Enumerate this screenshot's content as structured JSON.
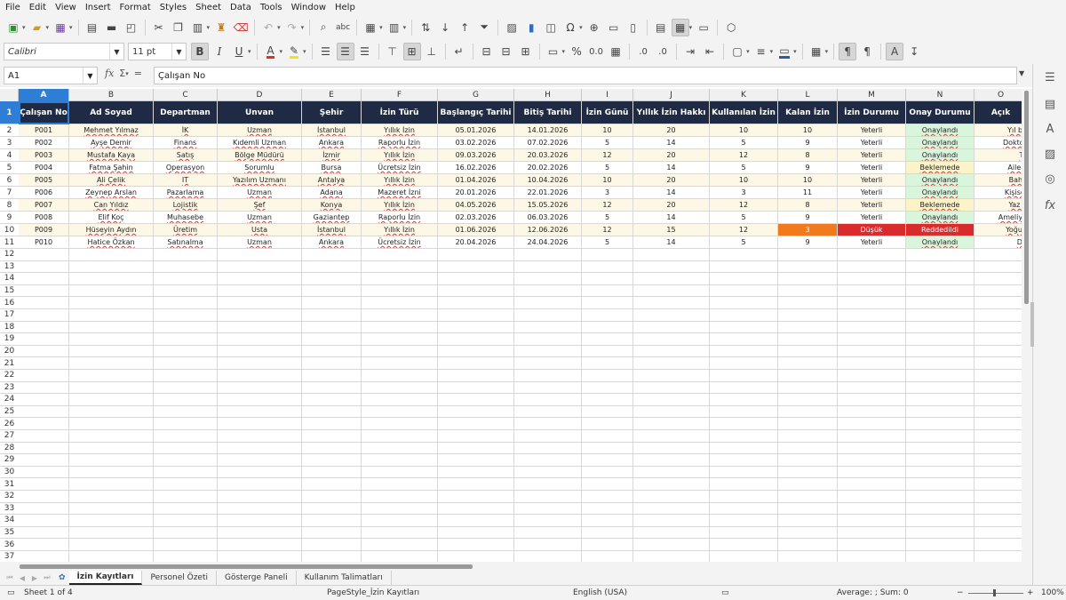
{
  "menu": [
    "File",
    "Edit",
    "View",
    "Insert",
    "Format",
    "Styles",
    "Sheet",
    "Data",
    "Tools",
    "Window",
    "Help"
  ],
  "format_bar": {
    "font_name": "Calibri",
    "font_size": "11 pt"
  },
  "formula_bar": {
    "cell_ref": "A1",
    "content": "Çalışan No"
  },
  "columns": [
    "A",
    "B",
    "C",
    "D",
    "E",
    "F",
    "G",
    "H",
    "I",
    "J",
    "K",
    "L",
    "M",
    "N",
    "O"
  ],
  "table": {
    "headers": [
      "Çalışan No",
      "Ad Soyad",
      "Departman",
      "Unvan",
      "Şehir",
      "İzin Türü",
      "Başlangıç Tarihi",
      "Bitiş Tarihi",
      "İzin Günü",
      "Yıllık İzin Hakkı",
      "Kullanılan İzin",
      "Kalan İzin",
      "İzin Durumu",
      "Onay Durumu",
      "Açık"
    ],
    "rows": [
      [
        "P001",
        "Mehmet Yılmaz",
        "İK",
        "Uzman",
        "İstanbul",
        "Yıllık İzin",
        "05.01.2026",
        "14.01.2026",
        "10",
        "20",
        "10",
        "10",
        "Yeterli",
        "Onaylandı",
        "Yıl ba"
      ],
      [
        "P002",
        "Ayşe Demir",
        "Finans",
        "Kıdemli Uzman",
        "Ankara",
        "Raporlu İzin",
        "03.02.2026",
        "07.02.2026",
        "5",
        "14",
        "5",
        "9",
        "Yeterli",
        "Onaylandı",
        "Doktor"
      ],
      [
        "P003",
        "Mustafa Kaya",
        "Satış",
        "Bölge Müdürü",
        "İzmir",
        "Yıllık İzin",
        "09.03.2026",
        "20.03.2026",
        "12",
        "20",
        "12",
        "8",
        "Yeterli",
        "Onaylandı",
        "Ta"
      ],
      [
        "P004",
        "Fatma Şahin",
        "Operasyon",
        "Sorumlu",
        "Bursa",
        "Ücretsiz İzin",
        "16.02.2026",
        "20.02.2026",
        "5",
        "14",
        "5",
        "9",
        "Yeterli",
        "Beklemede",
        "Aile z"
      ],
      [
        "P005",
        "Ali Çelik",
        "IT",
        "Yazılım Uzmanı",
        "Antalya",
        "Yıllık İzin",
        "01.04.2026",
        "10.04.2026",
        "10",
        "20",
        "10",
        "10",
        "Yeterli",
        "Onaylandı",
        "Baha"
      ],
      [
        "P006",
        "Zeynep Arslan",
        "Pazarlama",
        "Uzman",
        "Adana",
        "Mazeret İzni",
        "20.01.2026",
        "22.01.2026",
        "3",
        "14",
        "3",
        "11",
        "Yeterli",
        "Onaylandı",
        "Kişisel"
      ],
      [
        "P007",
        "Can Yıldız",
        "Lojistik",
        "Şef",
        "Konya",
        "Yıllık İzin",
        "04.05.2026",
        "15.05.2026",
        "12",
        "20",
        "12",
        "8",
        "Yeterli",
        "Beklemede",
        "Yaz d"
      ],
      [
        "P008",
        "Elif Koç",
        "Muhasebe",
        "Uzman",
        "Gaziantep",
        "Raporlu İzin",
        "02.03.2026",
        "06.03.2026",
        "5",
        "14",
        "5",
        "9",
        "Yeterli",
        "Onaylandı",
        "Ameliya"
      ],
      [
        "P009",
        "Hüseyin Aydın",
        "Üretim",
        "Usta",
        "İstanbul",
        "Yıllık İzin",
        "01.06.2026",
        "12.06.2026",
        "12",
        "15",
        "12",
        "3",
        "Düşük",
        "Reddedildi",
        "Yoğun"
      ],
      [
        "P010",
        "Hatice Özkan",
        "Satınalma",
        "Uzman",
        "Ankara",
        "Ücretsiz İzin",
        "20.04.2026",
        "24.04.2026",
        "5",
        "14",
        "5",
        "9",
        "Yeterli",
        "Onaylandı",
        "Dü"
      ]
    ],
    "empty_row_numbers": [
      "12",
      "13",
      "14",
      "15",
      "16",
      "17",
      "18",
      "19",
      "20",
      "21",
      "22",
      "23",
      "24",
      "25",
      "26",
      "27",
      "28",
      "29",
      "30",
      "31",
      "32",
      "33",
      "34",
      "35",
      "36",
      "37"
    ]
  },
  "sheet_tabs": [
    "İzin Kayıtları",
    "Personel Özeti",
    "Gösterge Paneli",
    "Kullanım Talimatları"
  ],
  "active_sheet": "İzin Kayıtları",
  "status": {
    "sheet_info": "Sheet 1 of 4",
    "page_style": "PageStyle_İzin Kayıtları",
    "language": "English (USA)",
    "summary": "Average: ; Sum: 0",
    "zoom": "100%"
  },
  "colors": {
    "header_bg": "#1f2a44",
    "selection": "#2d7ed4",
    "approved": "#d9f5dc",
    "pending": "#fdf3c8",
    "rejected": "#d92b2b",
    "warning": "#f07a1c"
  }
}
